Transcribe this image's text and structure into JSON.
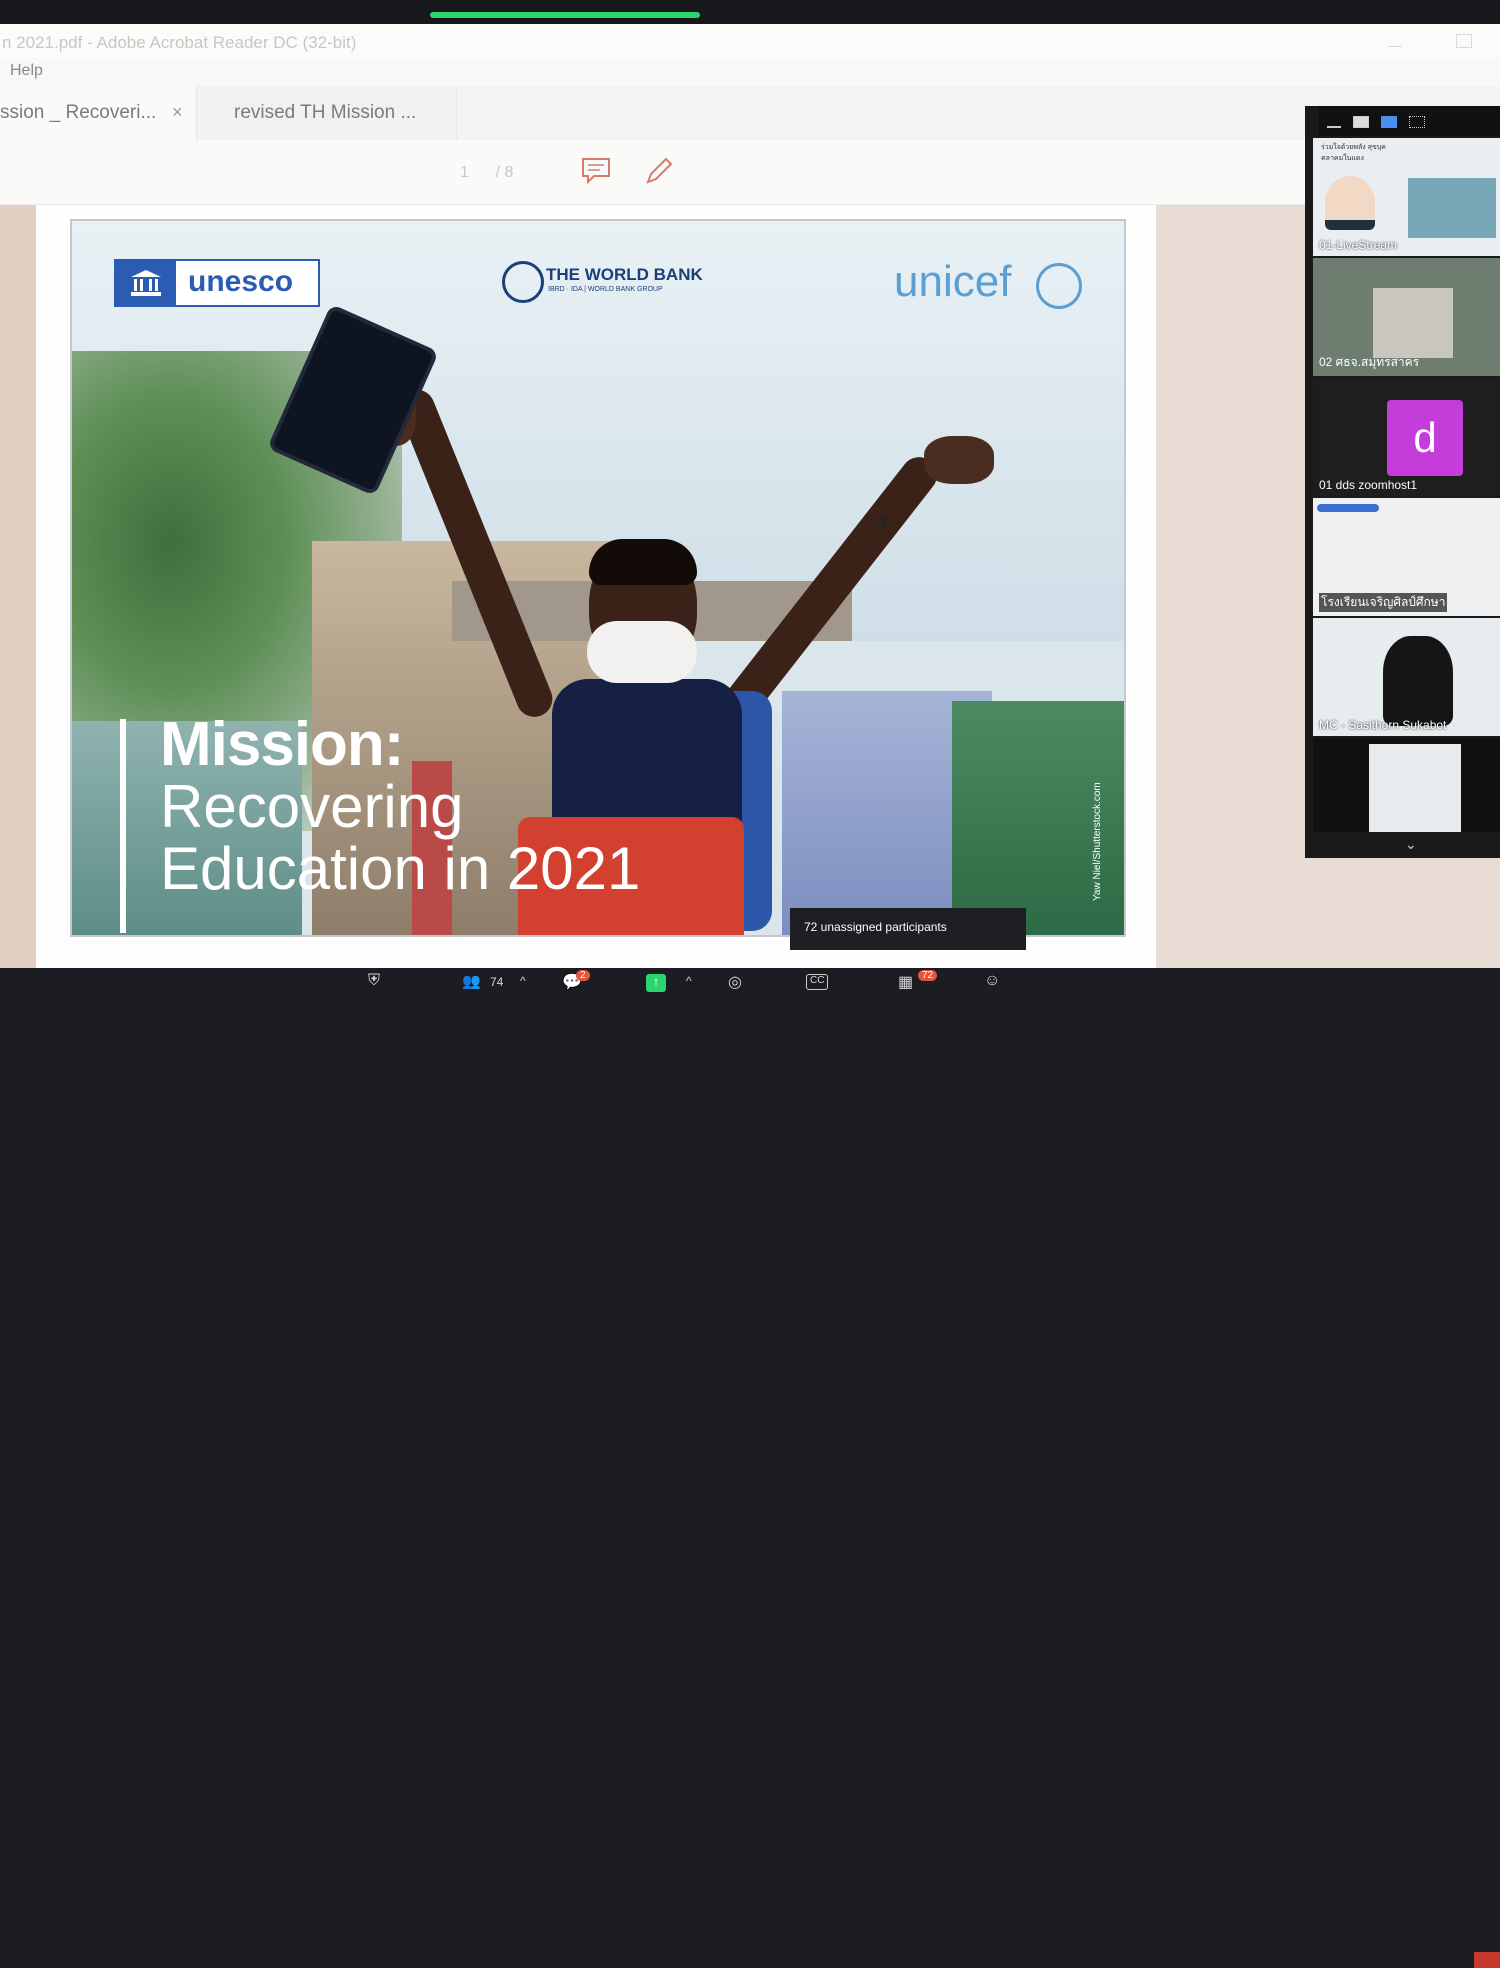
{
  "window": {
    "title": "n 2021.pdf - Adobe Acrobat Reader DC (32-bit)",
    "menu": [
      "Help"
    ]
  },
  "tabs": [
    {
      "label": "ssion _ Recoveri...",
      "close": "×",
      "active": true
    },
    {
      "label": "revised TH Mission ...",
      "active": false
    }
  ],
  "toolbar": {
    "page_current": "1",
    "page_total": "/ 8"
  },
  "slide": {
    "logos": {
      "unesco": "unesco",
      "world_bank": "THE WORLD BANK",
      "world_bank_sub": "IBRD · IDA | WORLD BANK GROUP",
      "unicef": "unicef"
    },
    "title_line1": "Mission:",
    "title_line2": "Recovering",
    "title_line3": "Education in 2021",
    "photo_credit": "Yaw Niel/Shutterstock.com"
  },
  "tooltip": {
    "text": "72 unassigned participants"
  },
  "participants_panel": {
    "tiles": [
      {
        "name": "01-LiveStream",
        "thumb_text": "ร่วมใจด้วยพลัง สุขบุคคลาคมในแดง"
      },
      {
        "name": "02 ศธจ.สมุทรสาคร"
      },
      {
        "name": "01 dds zoomhost1",
        "avatar_letter": "d"
      },
      {
        "name": "โรงเรียนเจริญศิลป์ศึกษา"
      },
      {
        "name": "MC - Sasithorn Sukabot"
      },
      {
        "name": ""
      }
    ]
  },
  "zoom_bar": {
    "participants_count": "74",
    "chat_badge": "2",
    "breakout_badge": "72",
    "cc_label": "CC"
  },
  "colors": {
    "unesco_blue": "#2b5cb3",
    "worldbank_navy": "#1a3f7a",
    "unicef_blue": "#5a9fd4",
    "zoom_avatar": "#c43cd9",
    "share_green": "#2ad66b",
    "badge_red": "#e8533b"
  }
}
